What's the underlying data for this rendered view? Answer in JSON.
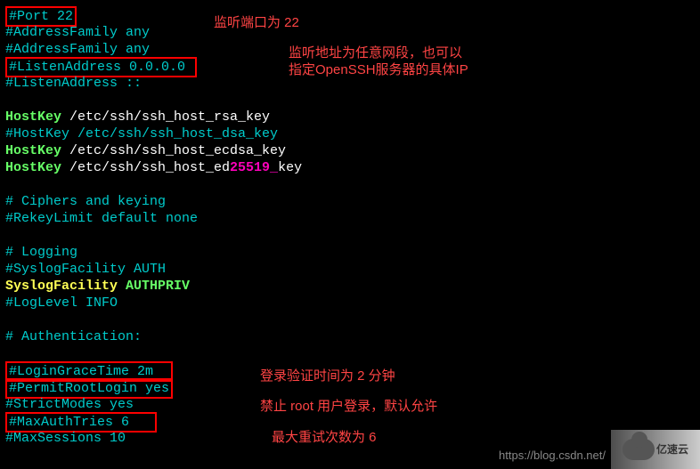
{
  "lines": {
    "l1_port": "#Port 22",
    "l2": "#AddressFamily any",
    "l3": "#AddressFamily any",
    "l4_listen": "#ListenAddress 0.0.0.0 ",
    "l5": "#ListenAddress ::",
    "l6_key": "HostKey",
    "l6_path": " /etc/ssh/ssh_host_rsa_key",
    "l7": "#HostKey /etc/ssh/ssh_host_dsa_key",
    "l8_key": "HostKey",
    "l8_path": " /etc/ssh/ssh_host_ecdsa_key",
    "l9_key": "HostKey",
    "l9_path1": " /etc/ssh/ssh_host_ed",
    "l9_num": "25519_",
    "l9_path2": "key",
    "l10": "# Ciphers and keying",
    "l11": "#RekeyLimit default none",
    "l12": "# Logging",
    "l13": "#SyslogFacility AUTH",
    "l14_key": "SyslogFacility",
    "l14_val": "AUTHPRIV",
    "l15": "#LogLevel INFO",
    "l16": "# Authentication:",
    "l17_box": "#LoginGraceTime 2m  ",
    "l18_box": "#PermitRootLogin yes",
    "l19": "#StrictModes yes",
    "l20_box": "#MaxAuthTries 6   ",
    "l21": "#MaxSessions 10"
  },
  "annotations": {
    "a1": "监听端口为 22",
    "a2": "监听地址为任意网段，也可以",
    "a3": "指定OpenSSH服务器的具体IP",
    "a4": "登录验证时间为 2 分钟",
    "a5": "禁止 root 用户登录，默认允许",
    "a6": "最大重试次数为 6"
  },
  "watermark": {
    "url": "https://blog.csdn.net/",
    "logo": "亿速云"
  }
}
